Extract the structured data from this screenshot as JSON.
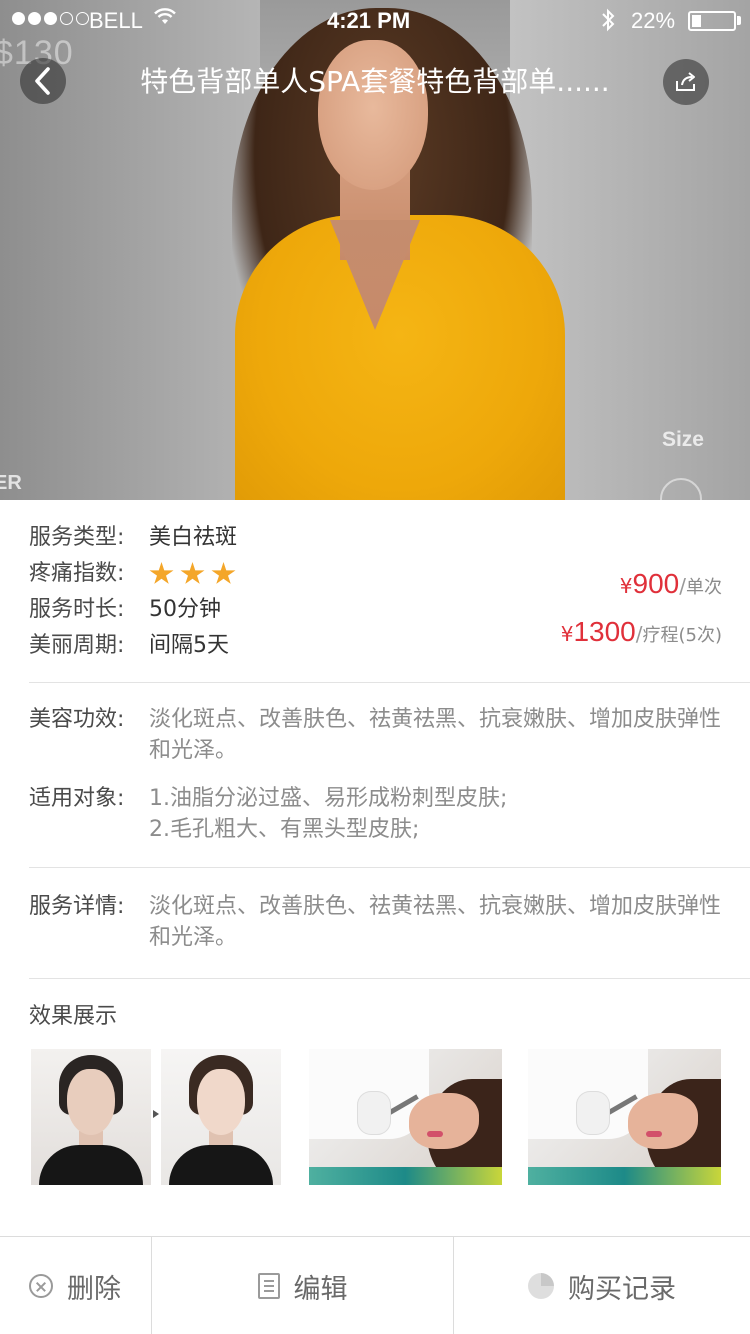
{
  "status_bar": {
    "carrier": "BELL",
    "time": "4:21 PM",
    "battery": "22%",
    "battery_level": 0.22
  },
  "nav": {
    "title": "特色背部单人SPA套餐特色背部单......",
    "back_icon": "chevron-left-icon",
    "share_icon": "share-icon"
  },
  "hero": {
    "ghost_price": "$130",
    "ghost_size": "Size",
    "ghost_er": "ER"
  },
  "info": {
    "rows": [
      {
        "label": "服务类型:",
        "value": "美白祛斑"
      },
      {
        "label": "疼痛指数:",
        "stars": 3
      },
      {
        "label": "服务时长:",
        "value": "50分钟"
      },
      {
        "label": "美丽周期:",
        "value": "间隔5天"
      }
    ],
    "prices": [
      {
        "currency": "¥",
        "amount": "900",
        "separator": "/",
        "unit": "单次"
      },
      {
        "currency": "¥",
        "amount": "1300",
        "separator": "/",
        "unit": "疗程(5次)"
      }
    ],
    "accent_color": "#e0303a",
    "star_color": "#f4a629"
  },
  "details": {
    "effect": {
      "label": "美容功效:",
      "text": "淡化斑点、改善肤色、祛黄祛黑、抗衰嫩肤、增加皮肤弹性和光泽。"
    },
    "target": {
      "label": "适用对象:",
      "line1": "1.油脂分泌过盛、易形成粉刺型皮肤;",
      "line2": "2.毛孔粗大、有黑头型皮肤;"
    },
    "service": {
      "label": "服务详情:",
      "text": "淡化斑点、改善肤色、祛黄祛黑、抗衰嫩肤、增加皮肤弹性和光泽。"
    }
  },
  "effects": {
    "title": "效果展示"
  },
  "bottom_bar": {
    "delete": {
      "label": "删除",
      "icon": "close-circle-icon"
    },
    "edit": {
      "label": "编辑",
      "icon": "document-icon"
    },
    "history": {
      "label": "购买记录",
      "icon": "pie-chart-icon"
    }
  }
}
